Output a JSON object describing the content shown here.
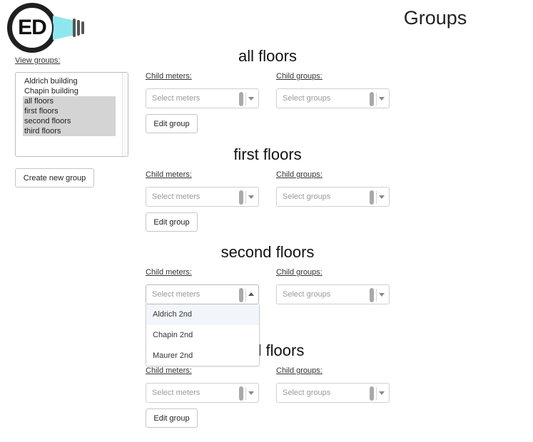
{
  "page": {
    "title": "Groups"
  },
  "logo": {
    "text": "ED"
  },
  "sidebar": {
    "view_label": "View groups:",
    "groups": [
      {
        "label": "Aldrich building",
        "selected": false
      },
      {
        "label": "Chapin building",
        "selected": false
      },
      {
        "label": "all floors",
        "selected": true
      },
      {
        "label": "first floors",
        "selected": true
      },
      {
        "label": "second floors",
        "selected": true
      },
      {
        "label": "third floors",
        "selected": true
      }
    ],
    "create_label": "Create new group"
  },
  "common": {
    "child_meters_label": "Child meters:",
    "child_groups_label": "Child groups:",
    "meters_placeholder": "Select meters",
    "groups_placeholder": "Select groups",
    "edit_label": "Edit group"
  },
  "sections": [
    {
      "title": "all floors"
    },
    {
      "title": "first floors"
    },
    {
      "title": "second floors"
    },
    {
      "title": "third floors"
    }
  ],
  "dropdown": {
    "options": [
      "Aldrich 2nd",
      "Chapin 2nd",
      "Maurer 2nd"
    ],
    "focused_option": "Aldrich 2nd"
  },
  "colors": {
    "selection": "#d4d4d4",
    "logo_beam": "#8ee7ef",
    "placeholder": "#9a9a9a"
  }
}
